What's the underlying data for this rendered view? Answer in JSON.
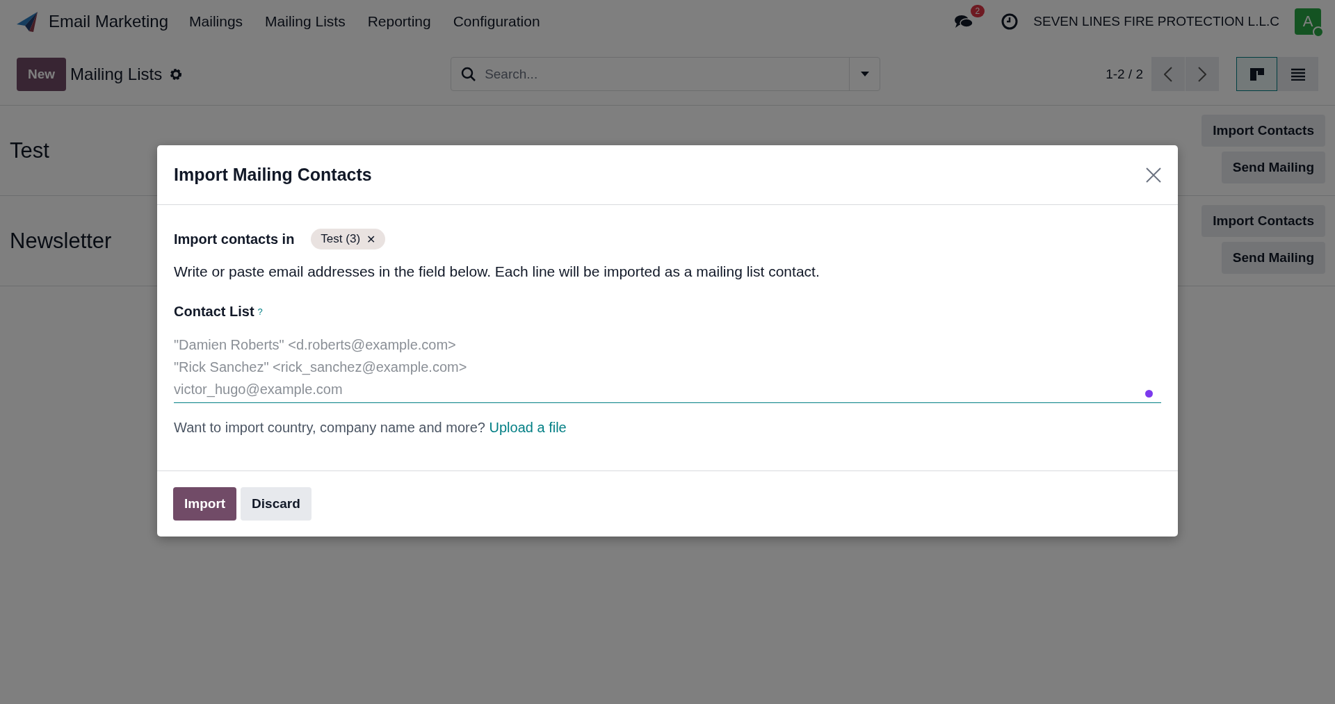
{
  "navbar": {
    "app_name": "Email Marketing",
    "menu": [
      "Mailings",
      "Mailing Lists",
      "Reporting",
      "Configuration"
    ],
    "messages_badge": "2",
    "company": "SEVEN LINES FIRE PROTECTION L.L.C",
    "avatar": "A"
  },
  "control_panel": {
    "new_button": "New",
    "title": "Mailing Lists",
    "search_placeholder": "Search...",
    "pager": "1-2 / 2",
    "views": [
      {
        "kind": "kanban",
        "selected": true
      },
      {
        "kind": "list",
        "selected": false
      }
    ]
  },
  "cards": [
    {
      "name": "Test",
      "buttons": [
        "Import Contacts",
        "Send Mailing"
      ]
    },
    {
      "name": "Newsletter",
      "buttons": [
        "Import Contacts",
        "Send Mailing"
      ]
    }
  ],
  "dialog": {
    "title": "Import Mailing Contacts",
    "target_label": "Import contacts in",
    "target_tag": "Test (3)",
    "tag_remove": "✕",
    "instructions": "Write or paste email addresses in the field below. Each line will be imported as a mailing list contact.",
    "field_label": "Contact List",
    "field_help": "?",
    "placeholder_lines": [
      "\"Damien Roberts\" <d.roberts@example.com>",
      "\"Rick Sanchez\" <rick_sanchez@example.com>",
      "victor_hugo@example.com"
    ],
    "upload_prompt": "Want to import country, company name and more?",
    "upload_link": "Upload a file",
    "buttons": [
      {
        "label": "Import",
        "kind": "primary"
      },
      {
        "label": "Discard",
        "kind": "secondary"
      }
    ]
  }
}
